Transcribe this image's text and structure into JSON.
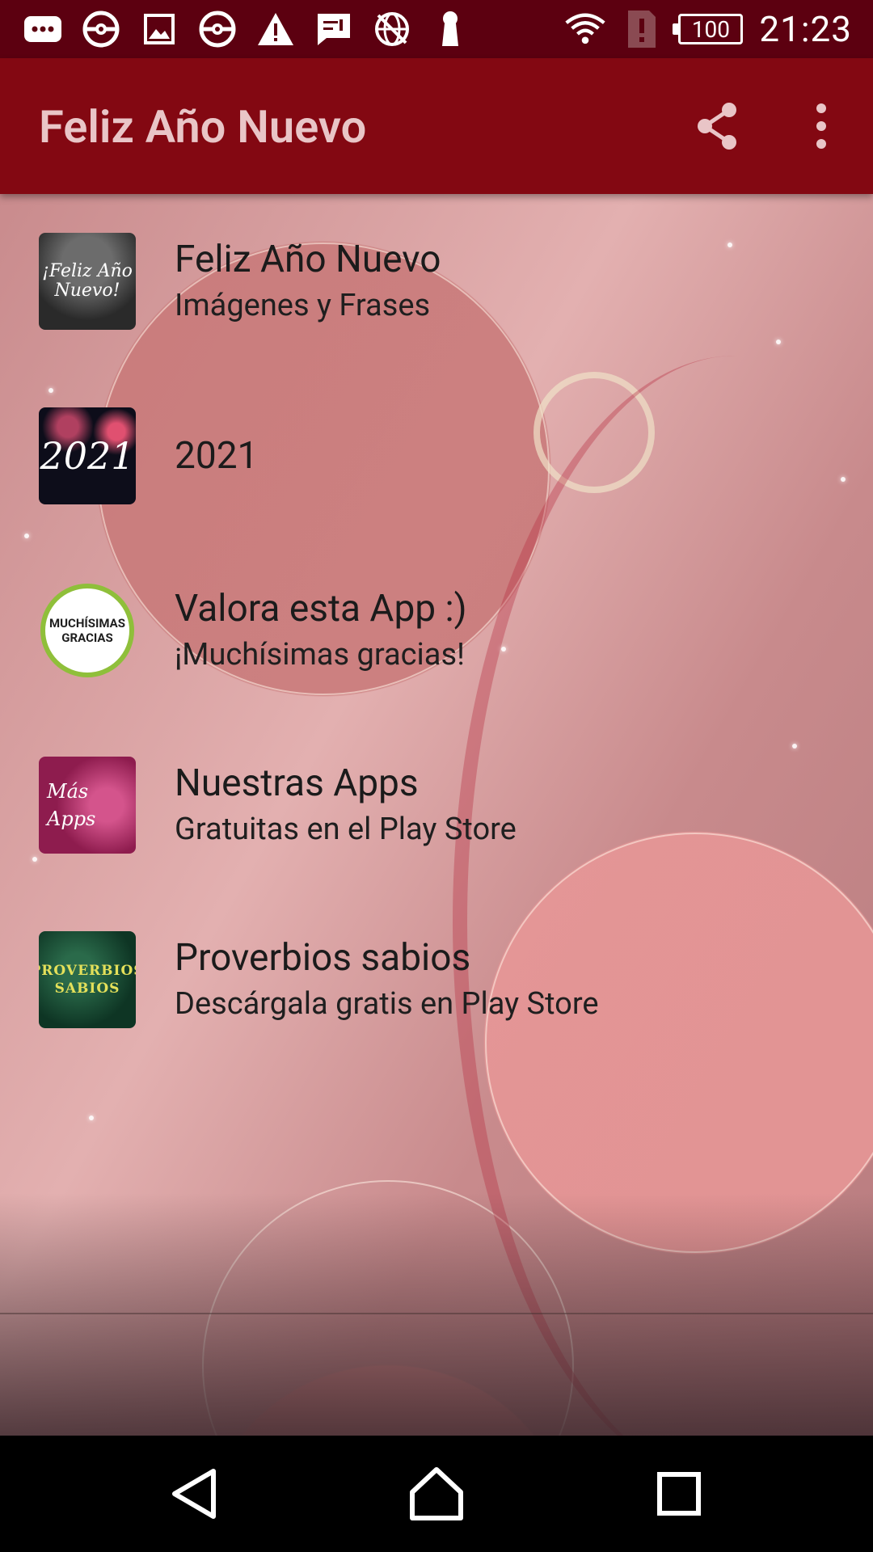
{
  "status_bar": {
    "time": "21:23",
    "battery": "100"
  },
  "app_bar": {
    "title": "Feliz Año Nuevo"
  },
  "menu": [
    {
      "title": "Feliz Año Nuevo",
      "subtitle": "Imágenes y Frases",
      "thumb_text": "¡Feliz Año Nuevo!"
    },
    {
      "title": "2021",
      "subtitle": "",
      "thumb_text": "2021"
    },
    {
      "title": "Valora esta App :)",
      "subtitle": "¡Muchísimas gracias!",
      "thumb_text": "MUCHÍSIMAS GRACIAS"
    },
    {
      "title": "Nuestras Apps",
      "subtitle": "Gratuitas en el Play Store",
      "thumb_text": "Más Apps"
    },
    {
      "title": "Proverbios sabios",
      "subtitle": "Descárgala gratis en Play Store",
      "thumb_text": "PROVERBIOS SABIOS"
    }
  ],
  "colors": {
    "status_bar": "#5c0010",
    "app_bar": "#830812",
    "title_text": "#e9c5c7"
  }
}
